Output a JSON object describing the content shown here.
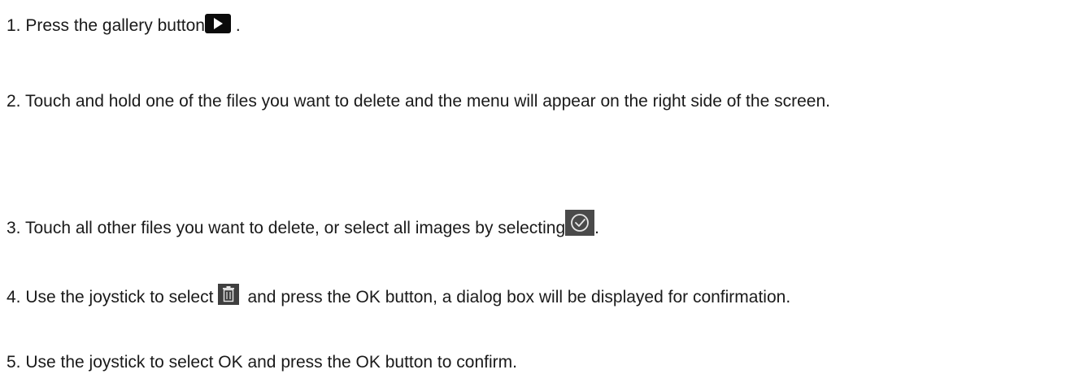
{
  "steps": [
    {
      "text_before": "1. Press the gallery button",
      "icon": "play-icon",
      "text_after": " ."
    },
    {
      "text": "2. Touch and hold one of the files you want to delete and the menu will appear on the right side of the screen."
    },
    {
      "text_before": "3. Touch all other files you want to delete, or select all images by selecting",
      "icon": "check-circle-icon",
      "text_after": "."
    },
    {
      "text_before": "4. Use the joystick to select",
      "icon": "trash-icon",
      "text_after": "and press the OK button, a dialog box will be displayed for confirmation."
    },
    {
      "text": "5. Use the joystick to select OK and press the OK button to confirm."
    }
  ],
  "colors": {
    "text": "#1a1a1a",
    "play_icon_bg": "#0b0b0b",
    "check_icon_bg": "#4a4a4a",
    "trash_icon_bg": "#3f3f3f"
  }
}
